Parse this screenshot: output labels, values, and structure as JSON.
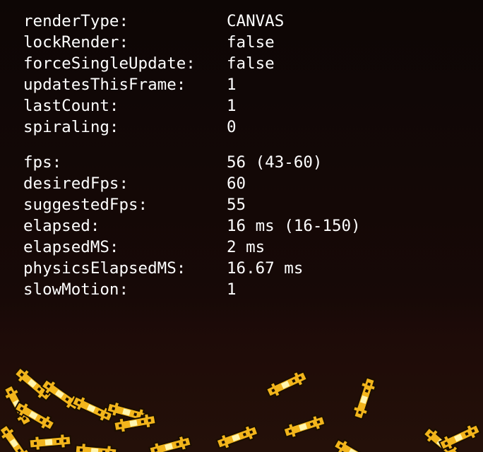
{
  "debug_group_1": [
    {
      "key": "renderType:",
      "value": "CANVAS"
    },
    {
      "key": "lockRender:",
      "value": "false"
    },
    {
      "key": "forceSingleUpdate:",
      "value": "false"
    },
    {
      "key": "updatesThisFrame:",
      "value": "1"
    },
    {
      "key": "lastCount:",
      "value": "1"
    },
    {
      "key": "spiraling:",
      "value": "0"
    }
  ],
  "debug_group_2": [
    {
      "key": "fps:",
      "value": "56 (43-60)"
    },
    {
      "key": "desiredFps:",
      "value": "60"
    },
    {
      "key": "suggestedFps:",
      "value": "55"
    },
    {
      "key": "elapsed:",
      "value": "16 ms (16-150)"
    },
    {
      "key": "elapsedMS:",
      "value": "2 ms"
    },
    {
      "key": "physicsElapsedMS:",
      "value": "16.67 ms"
    },
    {
      "key": "slowMotion:",
      "value": "1"
    }
  ],
  "colors": {
    "text": "#ffffff",
    "background_top": "#0d0605",
    "background_bottom": "#241009",
    "sprite_body": "#f2b51c",
    "sprite_outline": "#1a0e00",
    "sprite_light": "#fff6b0"
  },
  "sprite_name": "glowing-cart-sprite"
}
